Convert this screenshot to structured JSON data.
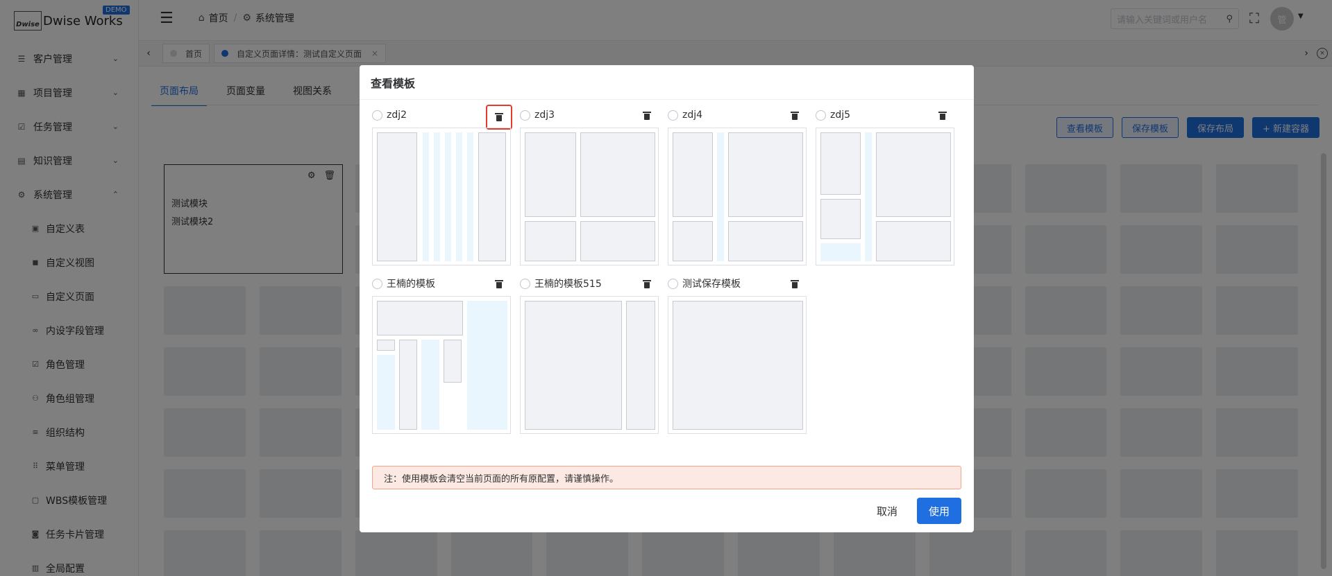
{
  "brand": {
    "logo_mark": "Dwise",
    "name": "Dwise Works",
    "badge": "DEMO"
  },
  "sidebar": {
    "items": [
      {
        "label": "客户管理",
        "icon": "menu-icon"
      },
      {
        "label": "项目管理",
        "icon": "grid-icon"
      },
      {
        "label": "任务管理",
        "icon": "check-icon"
      },
      {
        "label": "知识管理",
        "icon": "book-icon"
      },
      {
        "label": "系统管理",
        "icon": "gear-icon"
      }
    ],
    "sub_items": [
      {
        "label": "自定义表"
      },
      {
        "label": "自定义视图"
      },
      {
        "label": "自定义页面"
      },
      {
        "label": "内设字段管理"
      },
      {
        "label": "角色管理"
      },
      {
        "label": "角色组管理"
      },
      {
        "label": "组织结构"
      },
      {
        "label": "菜单管理"
      },
      {
        "label": "WBS模板管理"
      },
      {
        "label": "任务卡片管理"
      },
      {
        "label": "全局配置"
      }
    ]
  },
  "header": {
    "breadcrumb_home": "首页",
    "breadcrumb_current": "系统管理",
    "search_placeholder": "请输入关键词或用户名",
    "avatar_text": "管"
  },
  "tagsbar": {
    "tags": [
      {
        "label": "首页",
        "active": false
      },
      {
        "label": "自定义页面详情：测试自定义页面",
        "active": true
      }
    ]
  },
  "page": {
    "tabs": [
      "页面布局",
      "页面变量",
      "视图关系"
    ],
    "actions": [
      "查看模板",
      "保存模板",
      "保存布局",
      "+ 新建容器"
    ],
    "module": {
      "line1": "测试模块",
      "line2": "测试模块2"
    }
  },
  "modal": {
    "title": "查看模板",
    "templates": [
      {
        "name": "zdj2"
      },
      {
        "name": "zdj3"
      },
      {
        "name": "zdj4"
      },
      {
        "name": "zdj5"
      },
      {
        "name": "王楠的模板"
      },
      {
        "name": "王楠的模板515"
      },
      {
        "name": "测试保存模板"
      }
    ],
    "notice": "注：使用模板会清空当前页面的所有原配置，请谨慎操作。",
    "cancel_label": "取消",
    "use_label": "使用"
  },
  "colors": {
    "primary": "#1f6fe0",
    "highlight": "#e23b2c",
    "notice_bg": "#fde9e3"
  }
}
